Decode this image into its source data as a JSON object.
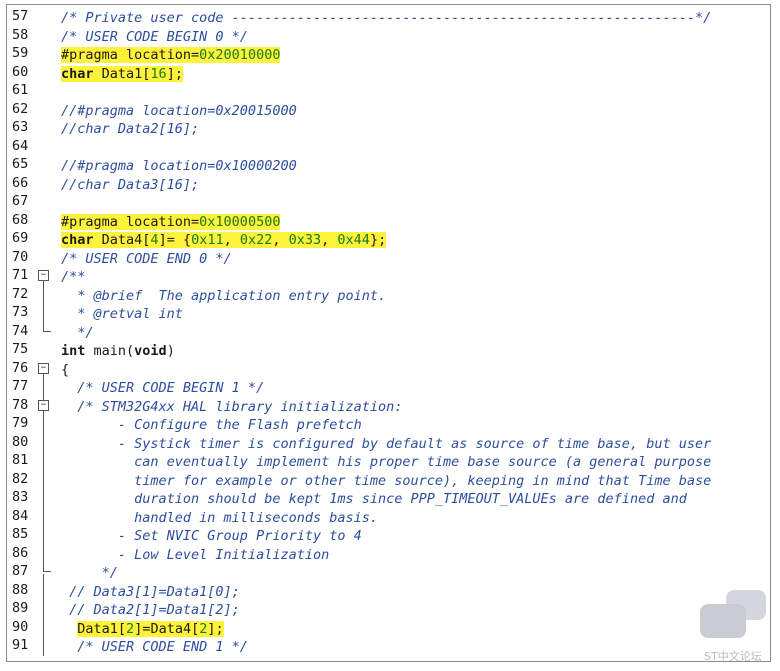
{
  "editor": {
    "lines": [
      {
        "n": "57",
        "text": "/* Private user code ---------------------------------------------------------*/",
        "style": "cm"
      },
      {
        "n": "58",
        "text": "/* USER CODE BEGIN 0 */",
        "style": "cm"
      },
      {
        "n": "59",
        "text": "#pragma location=0x20010000",
        "style": "pp",
        "hl": true
      },
      {
        "n": "60",
        "text": "char Data1[16];",
        "style": "decl",
        "hl": true
      },
      {
        "n": "61",
        "text": "",
        "style": ""
      },
      {
        "n": "62",
        "text": "//#pragma location=0x20015000",
        "style": "cm"
      },
      {
        "n": "63",
        "text": "//char Data2[16];",
        "style": "cm"
      },
      {
        "n": "64",
        "text": "",
        "style": ""
      },
      {
        "n": "65",
        "text": "//#pragma location=0x10000200",
        "style": "cm"
      },
      {
        "n": "66",
        "text": "//char Data3[16];",
        "style": "cm"
      },
      {
        "n": "67",
        "text": "",
        "style": ""
      },
      {
        "n": "68",
        "text": "#pragma location=0x10000500",
        "style": "pp",
        "hl": true
      },
      {
        "n": "69",
        "text": "char Data4[4]= {0x11, 0x22, 0x33, 0x44};",
        "style": "decl",
        "hl": true
      },
      {
        "n": "70",
        "text": "/* USER CODE END 0 */",
        "style": "cm"
      },
      {
        "n": "71",
        "text": "/**",
        "style": "cm"
      },
      {
        "n": "72",
        "text": "  * @brief  The application entry point.",
        "style": "cm"
      },
      {
        "n": "73",
        "text": "  * @retval int",
        "style": "cm"
      },
      {
        "n": "74",
        "text": "  */",
        "style": "cm"
      },
      {
        "n": "75",
        "text": "int main(void)",
        "style": "decl"
      },
      {
        "n": "76",
        "text": "{",
        "style": ""
      },
      {
        "n": "77",
        "text": "  /* USER CODE BEGIN 1 */",
        "style": "cm"
      },
      {
        "n": "78",
        "text": "  /* STM32G4xx HAL library initialization:",
        "style": "cm"
      },
      {
        "n": "79",
        "text": "       - Configure the Flash prefetch",
        "style": "cm"
      },
      {
        "n": "80",
        "text": "       - Systick timer is configured by default as source of time base, but user",
        "style": "cm"
      },
      {
        "n": "81",
        "text": "         can eventually implement his proper time base source (a general purpose",
        "style": "cm"
      },
      {
        "n": "82",
        "text": "         timer for example or other time source), keeping in mind that Time base",
        "style": "cm"
      },
      {
        "n": "83",
        "text": "         duration should be kept 1ms since PPP_TIMEOUT_VALUEs are defined and",
        "style": "cm"
      },
      {
        "n": "84",
        "text": "         handled in milliseconds basis.",
        "style": "cm"
      },
      {
        "n": "85",
        "text": "       - Set NVIC Group Priority to 4",
        "style": "cm"
      },
      {
        "n": "86",
        "text": "       - Low Level Initialization",
        "style": "cm"
      },
      {
        "n": "87",
        "text": "     */",
        "style": "cm"
      },
      {
        "n": "88",
        "text": " // Data3[1]=Data1[0];",
        "style": "cm"
      },
      {
        "n": "89",
        "text": " // Data2[1]=Data1[2];",
        "style": "cm"
      },
      {
        "n": "90",
        "text": "  Data1[2]=Data4[2];",
        "style": "decl",
        "hl": true
      },
      {
        "n": "91",
        "text": "  /* USER CODE END 1 */",
        "style": "cm"
      }
    ],
    "fold_markers": [
      "71",
      "76",
      "78"
    ]
  },
  "watermark": {
    "text": "ST中文论坛"
  }
}
